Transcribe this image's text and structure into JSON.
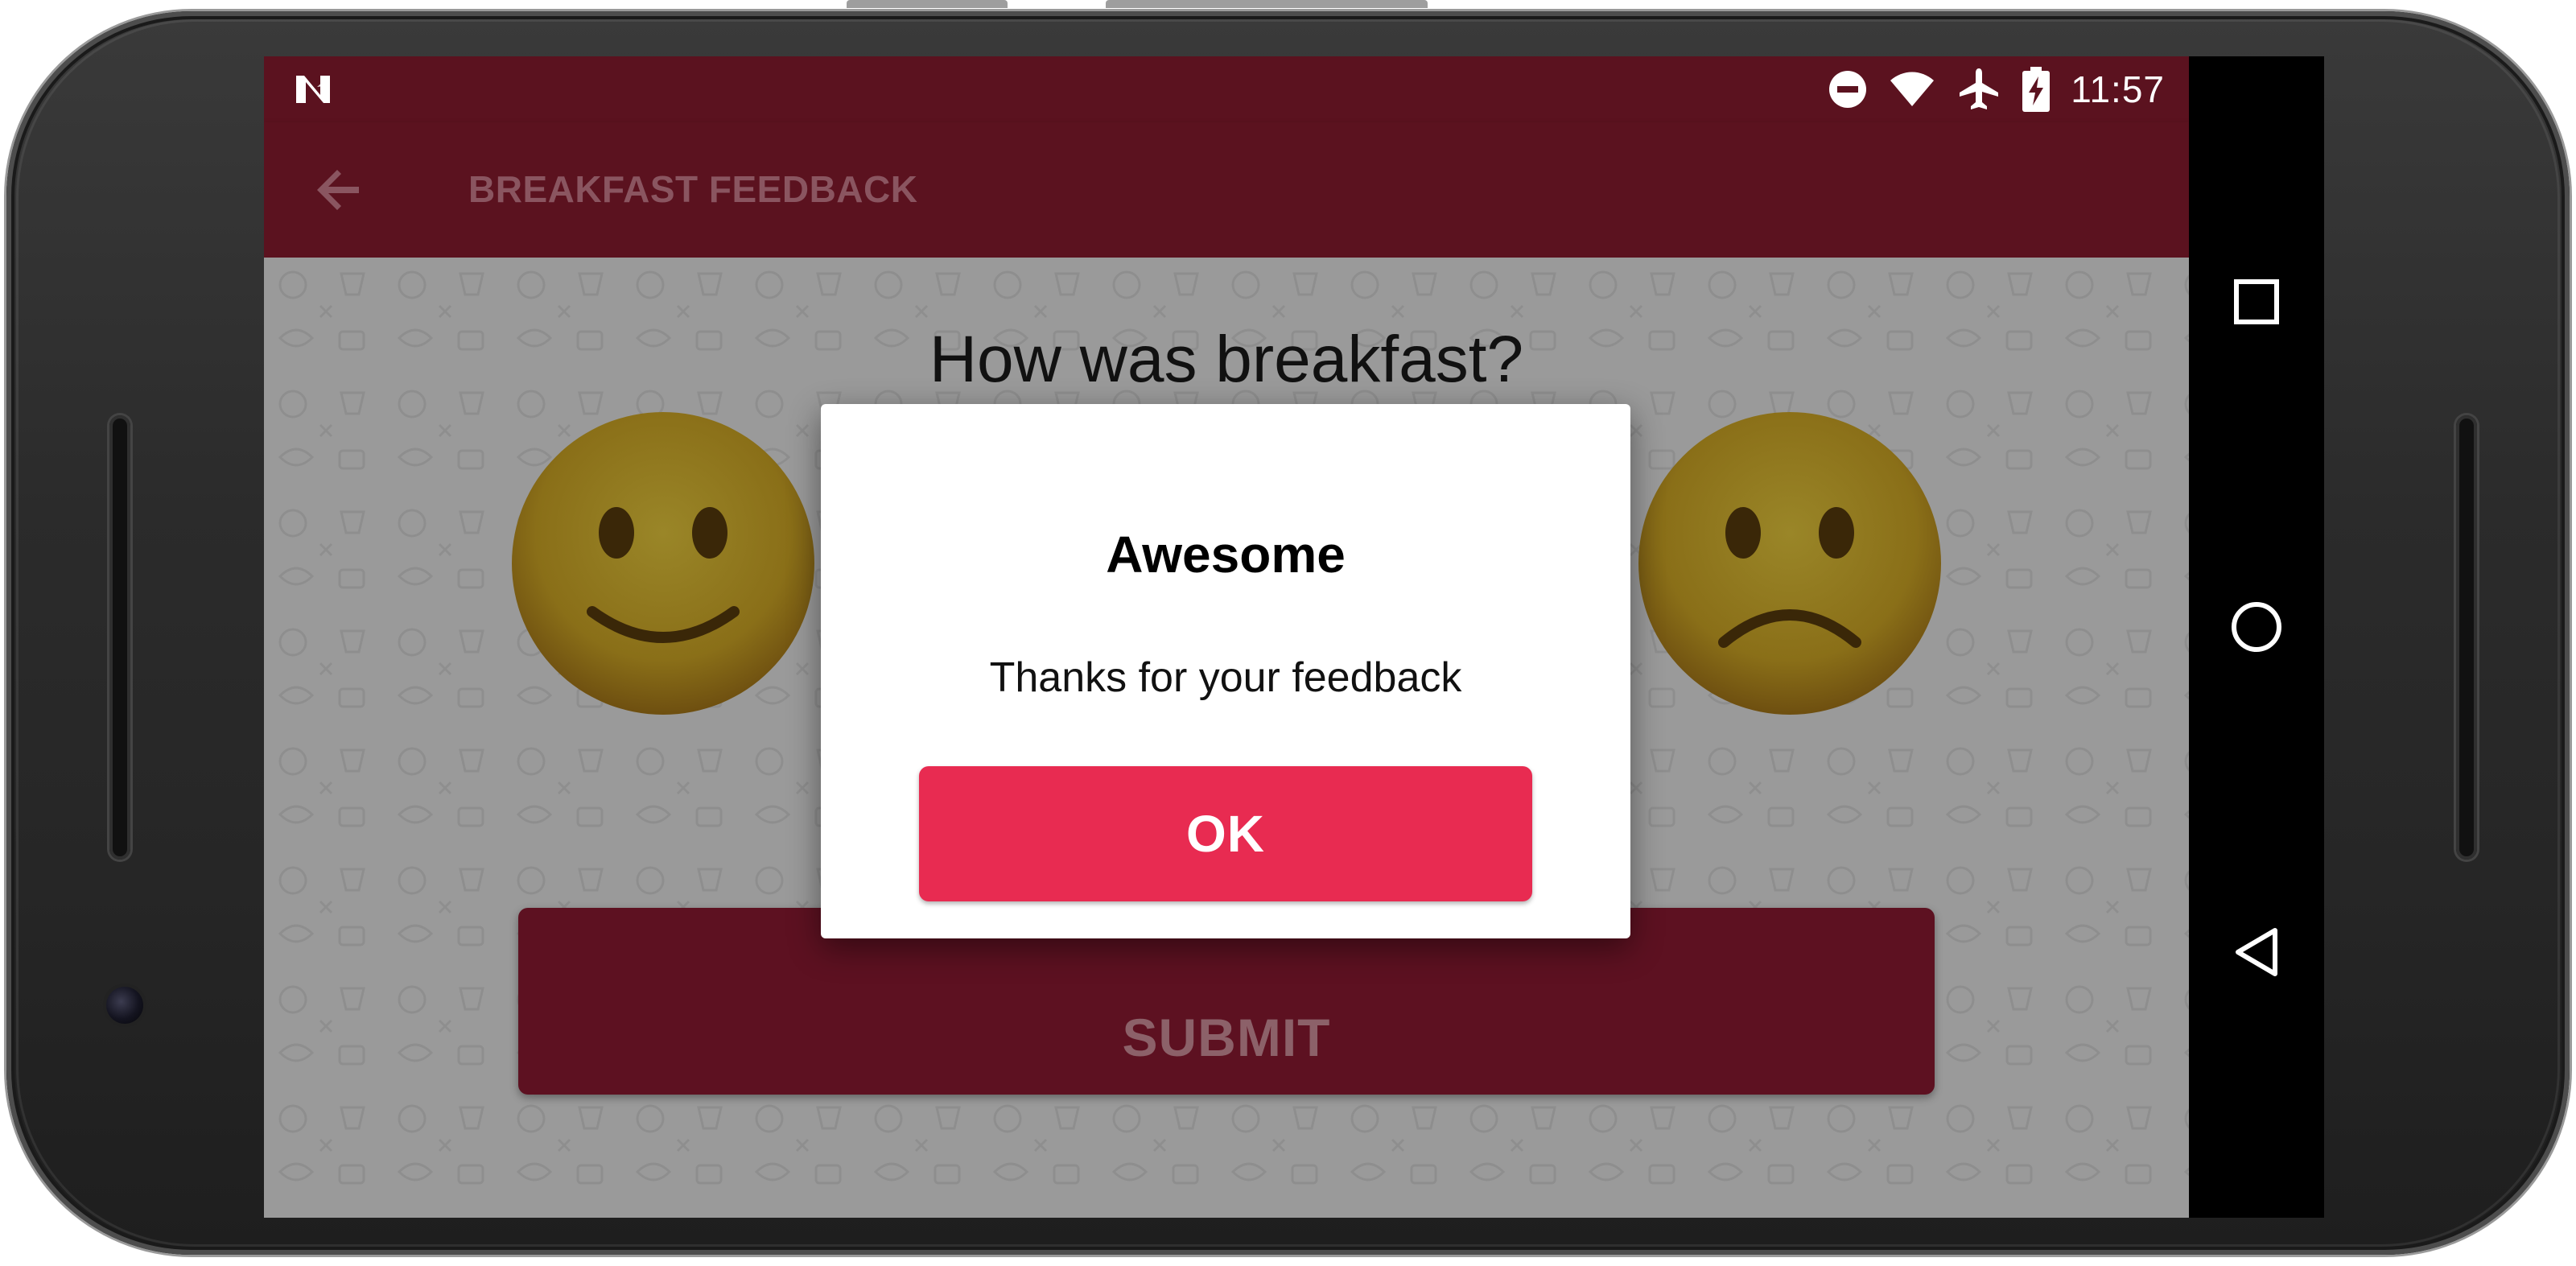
{
  "status_bar": {
    "time": "11:57",
    "icons": [
      "notification-n-icon",
      "do-not-disturb-icon",
      "wifi-icon",
      "airplane-mode-icon",
      "battery-charging-icon"
    ]
  },
  "toolbar": {
    "title": "BREAKFAST FEEDBACK",
    "back_icon": "arrow-back-icon"
  },
  "content": {
    "question": "How was breakfast?",
    "options": [
      {
        "icon": "slightly-smiling-face-icon"
      },
      {
        "icon": "slightly-frowning-face-icon"
      }
    ],
    "submit_label": "SUBMIT"
  },
  "dialog": {
    "title": "Awesome",
    "message": "Thanks for your feedback",
    "ok_label": "OK"
  },
  "nav_bar": {
    "buttons": [
      "recents-square-icon",
      "home-circle-icon",
      "back-triangle-icon"
    ]
  },
  "colors": {
    "primary_dark": "#5b121f",
    "accent": "#e82b51",
    "scrim_background": "#9a9a9a",
    "dialog_background": "#ffffff"
  }
}
